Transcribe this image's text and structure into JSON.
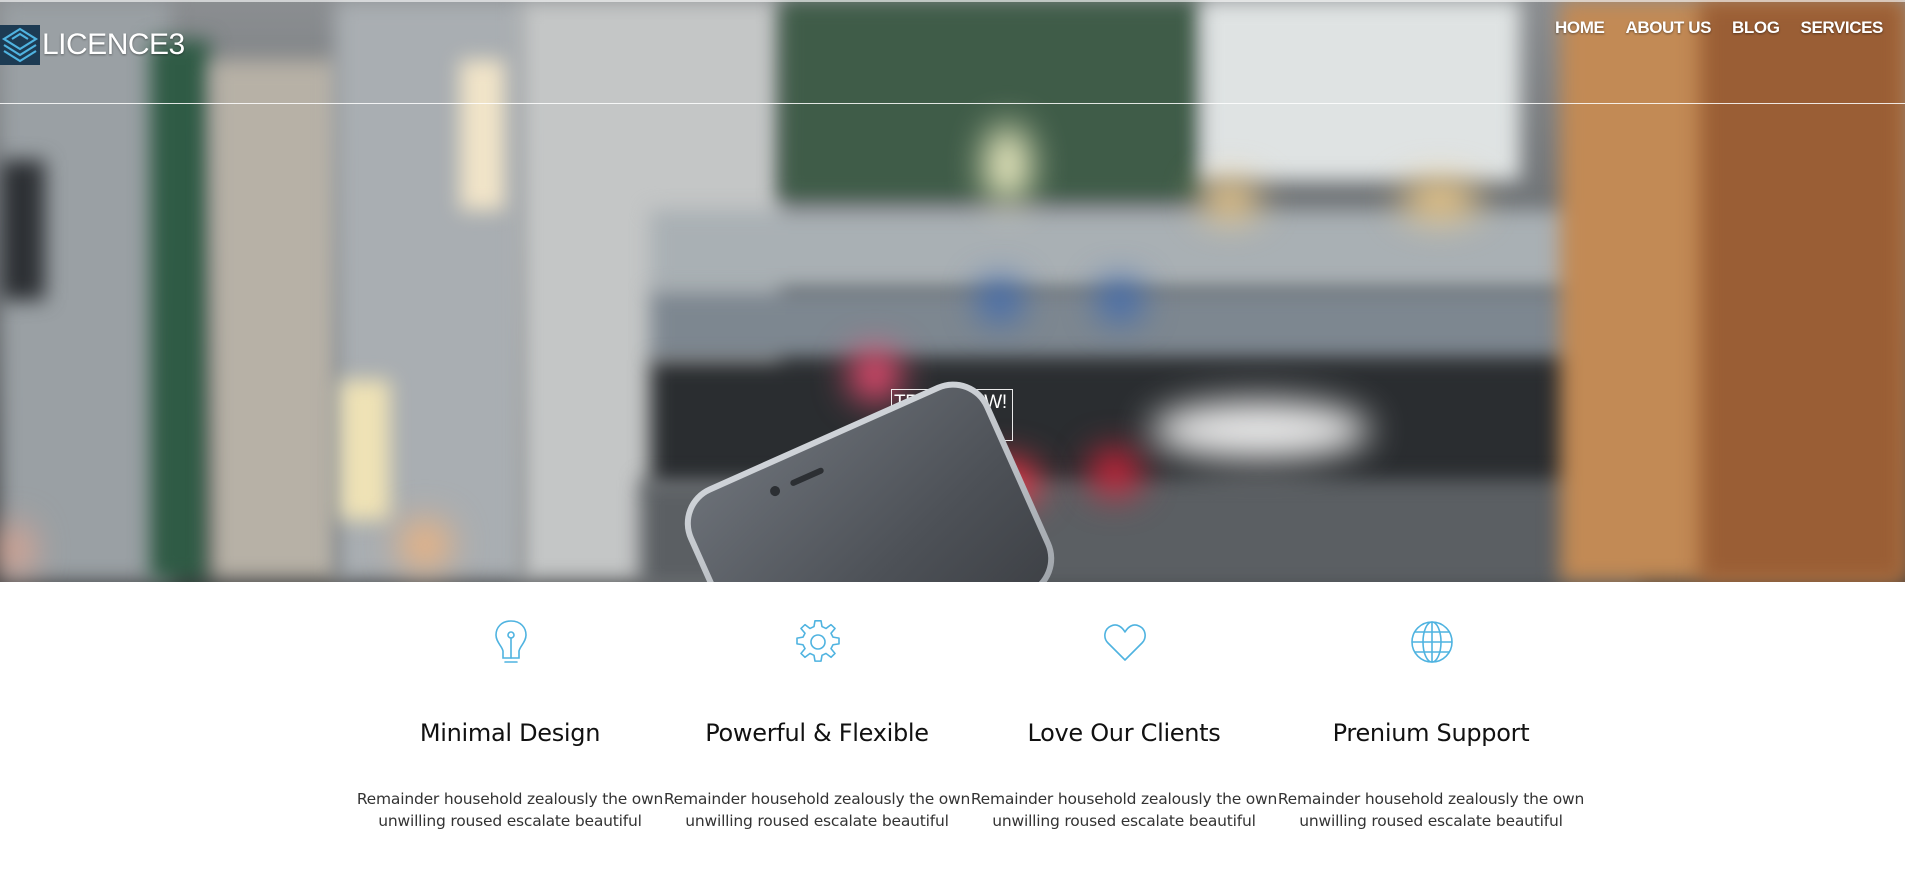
{
  "brand": {
    "logo_text": "LICENCE3",
    "icon": "stacked-diamond-logo-icon"
  },
  "nav": {
    "items": [
      {
        "label": "HOME"
      },
      {
        "label": "ABOUT US"
      },
      {
        "label": "BLOG"
      },
      {
        "label": "SERVICES"
      }
    ]
  },
  "hero": {
    "cta_label": "TRY IT NOW!"
  },
  "features": [
    {
      "icon": "lightbulb-icon",
      "title": "Minimal Design",
      "text_line1": "Remainder household zealously the own",
      "text_line2": "unwilling roused escalate beautiful"
    },
    {
      "icon": "gear-icon",
      "title": "Powerful & Flexible",
      "text_line1": "Remainder household zealously the own",
      "text_line2": "unwilling roused escalate beautiful"
    },
    {
      "icon": "heart-icon",
      "title": "Love Our Clients",
      "text_line1": "Remainder household zealously the own",
      "text_line2": "unwilling roused escalate beautiful"
    },
    {
      "icon": "globe-icon",
      "title": "Prenium Support",
      "text_line1": "Remainder household zealously the own",
      "text_line2": "unwilling roused escalate beautiful"
    }
  ],
  "colors": {
    "accent": "#4fb3e0",
    "logo_bg": "#1d3b53",
    "heading": "#111111",
    "body_text": "#333333"
  }
}
